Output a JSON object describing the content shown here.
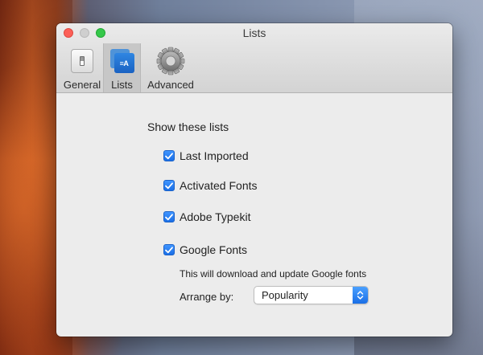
{
  "window": {
    "title": "Lists"
  },
  "toolbar": {
    "tabs": [
      {
        "label": "General",
        "icon": "general-switch-icon"
      },
      {
        "label": "Lists",
        "icon": "lists-icon",
        "selected": true,
        "icon_text": "≡A"
      },
      {
        "label": "Advanced",
        "icon": "gear-icon"
      }
    ]
  },
  "content": {
    "section_title": "Show these lists",
    "options": [
      {
        "label": "Last Imported",
        "checked": true
      },
      {
        "label": "Activated Fonts",
        "checked": true
      },
      {
        "label": "Adobe Typekit",
        "checked": true
      },
      {
        "label": "Google Fonts",
        "checked": true
      }
    ],
    "google_hint": "This will download and update Google fonts",
    "arrange": {
      "label": "Arrange by:",
      "value": "Popularity"
    }
  },
  "colors": {
    "accent": "#1b6fe6",
    "close": "#fc5f57",
    "maximize": "#35c84a"
  }
}
